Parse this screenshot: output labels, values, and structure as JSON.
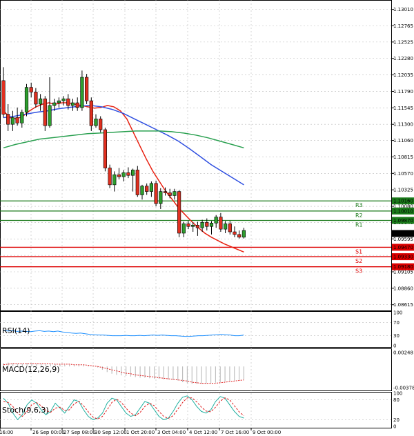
{
  "chart_data": [
    {
      "type": "candlestick",
      "title": "",
      "x_ticks": [
        "16:00",
        "26 Sep 00:00",
        "27 Sep 08:00",
        "30 Sep 12:00",
        "1 Oct 20:00",
        "3 Oct 04:00",
        "4 Oct 12:00",
        "7 Oct 16:00",
        "9 Oct 00:00"
      ],
      "y_ticks": [
        1.1301,
        1.12765,
        1.12525,
        1.1228,
        1.12035,
        1.1179,
        1.11545,
        1.113,
        1.1106,
        1.10815,
        1.1057,
        1.10325,
        1.1008,
        1.0984,
        1.09595,
        1.0935,
        1.09105,
        1.0886,
        1.08615
      ],
      "y_tick_labels": [
        "1.13010",
        "1.12765",
        "1.12525",
        "1.12280",
        "1.12035",
        "1.11790",
        "1.11545",
        "1.11300",
        "1.11060",
        "1.10815",
        "1.10570",
        "1.10325",
        "1.10080",
        "1.09840",
        "1.09595",
        "1.09350",
        "1.09105",
        "1.08860",
        "1.08615"
      ],
      "ylim": [
        1.0853,
        1.1315
      ],
      "current_price": {
        "value": 1.09675,
        "label": "1.09675"
      },
      "levels": [
        {
          "name": "R3",
          "value": 1.1016,
          "label": "1.10160",
          "color": "#1a7a1a"
        },
        {
          "name": "R2",
          "value": 1.1001,
          "label": "1.10010",
          "color": "#1a7a1a"
        },
        {
          "name": "R1",
          "value": 1.0987,
          "label": "1.09870",
          "color": "#1a7a1a"
        },
        {
          "name": "S1",
          "value": 1.0947,
          "label": "1.09470",
          "color": "#dd0000"
        },
        {
          "name": "S2",
          "value": 1.0933,
          "label": "1.09330",
          "color": "#dd0000"
        },
        {
          "name": "S3",
          "value": 1.0918,
          "label": "1.09180",
          "color": "#dd0000"
        }
      ],
      "candles": [
        {
          "o": 1.1195,
          "h": 1.1215,
          "l": 1.114,
          "c": 1.1145
        },
        {
          "o": 1.1145,
          "h": 1.116,
          "l": 1.112,
          "c": 1.113
        },
        {
          "o": 1.113,
          "h": 1.115,
          "l": 1.112,
          "c": 1.114
        },
        {
          "o": 1.114,
          "h": 1.1155,
          "l": 1.1128,
          "c": 1.1132
        },
        {
          "o": 1.1132,
          "h": 1.1152,
          "l": 1.1125,
          "c": 1.1148
        },
        {
          "o": 1.1148,
          "h": 1.119,
          "l": 1.1142,
          "c": 1.1185
        },
        {
          "o": 1.1185,
          "h": 1.1192,
          "l": 1.117,
          "c": 1.1178
        },
        {
          "o": 1.1178,
          "h": 1.1184,
          "l": 1.1155,
          "c": 1.116
        },
        {
          "o": 1.116,
          "h": 1.1175,
          "l": 1.115,
          "c": 1.1168
        },
        {
          "o": 1.1168,
          "h": 1.1172,
          "l": 1.112,
          "c": 1.1128
        },
        {
          "o": 1.1128,
          "h": 1.12,
          "l": 1.1125,
          "c": 1.1158
        },
        {
          "o": 1.1158,
          "h": 1.1168,
          "l": 1.115,
          "c": 1.1162
        },
        {
          "o": 1.1162,
          "h": 1.117,
          "l": 1.1155,
          "c": 1.1165
        },
        {
          "o": 1.1165,
          "h": 1.1172,
          "l": 1.1158,
          "c": 1.1168
        },
        {
          "o": 1.1168,
          "h": 1.1175,
          "l": 1.1152,
          "c": 1.1158
        },
        {
          "o": 1.1158,
          "h": 1.1168,
          "l": 1.115,
          "c": 1.1162
        },
        {
          "o": 1.1162,
          "h": 1.117,
          "l": 1.115,
          "c": 1.1155
        },
        {
          "o": 1.1155,
          "h": 1.121,
          "l": 1.115,
          "c": 1.12
        },
        {
          "o": 1.12,
          "h": 1.1205,
          "l": 1.116,
          "c": 1.1165
        },
        {
          "o": 1.1165,
          "h": 1.117,
          "l": 1.112,
          "c": 1.1128
        },
        {
          "o": 1.1128,
          "h": 1.1145,
          "l": 1.1125,
          "c": 1.1138
        },
        {
          "o": 1.1138,
          "h": 1.1142,
          "l": 1.1118,
          "c": 1.1122
        },
        {
          "o": 1.1122,
          "h": 1.1125,
          "l": 1.106,
          "c": 1.1065
        },
        {
          "o": 1.1065,
          "h": 1.107,
          "l": 1.1035,
          "c": 1.104
        },
        {
          "o": 1.104,
          "h": 1.106,
          "l": 1.103,
          "c": 1.1055
        },
        {
          "o": 1.1055,
          "h": 1.1065,
          "l": 1.1048,
          "c": 1.1052
        },
        {
          "o": 1.1052,
          "h": 1.1062,
          "l": 1.1045,
          "c": 1.1058
        },
        {
          "o": 1.1058,
          "h": 1.1066,
          "l": 1.105,
          "c": 1.1054
        },
        {
          "o": 1.1054,
          "h": 1.1064,
          "l": 1.103,
          "c": 1.1062
        },
        {
          "o": 1.1062,
          "h": 1.1068,
          "l": 1.1022,
          "c": 1.1025
        },
        {
          "o": 1.1025,
          "h": 1.104,
          "l": 1.1018,
          "c": 1.1038
        },
        {
          "o": 1.1038,
          "h": 1.1042,
          "l": 1.1025,
          "c": 1.103
        },
        {
          "o": 1.103,
          "h": 1.1045,
          "l": 1.1022,
          "c": 1.1042
        },
        {
          "o": 1.1042,
          "h": 1.1046,
          "l": 1.1008,
          "c": 1.1012
        },
        {
          "o": 1.1012,
          "h": 1.1035,
          "l": 1.1004,
          "c": 1.103
        },
        {
          "o": 1.103,
          "h": 1.1036,
          "l": 1.1024,
          "c": 1.1028
        },
        {
          "o": 1.1028,
          "h": 1.1034,
          "l": 1.102,
          "c": 1.1024
        },
        {
          "o": 1.1024,
          "h": 1.1034,
          "l": 1.1018,
          "c": 1.103
        },
        {
          "o": 1.103,
          "h": 1.1032,
          "l": 1.0962,
          "c": 1.0968
        },
        {
          "o": 1.0968,
          "h": 1.0985,
          "l": 1.0962,
          "c": 1.0982
        },
        {
          "o": 1.0982,
          "h": 1.0986,
          "l": 1.0974,
          "c": 1.0978
        },
        {
          "o": 1.0978,
          "h": 1.0984,
          "l": 1.097,
          "c": 1.098
        },
        {
          "o": 1.098,
          "h": 1.0985,
          "l": 1.0964,
          "c": 1.0976
        },
        {
          "o": 1.0976,
          "h": 1.0988,
          "l": 1.097,
          "c": 1.0984
        },
        {
          "o": 1.0984,
          "h": 1.099,
          "l": 1.0972,
          "c": 1.0978
        },
        {
          "o": 1.0978,
          "h": 1.0986,
          "l": 1.0966,
          "c": 1.0983
        },
        {
          "o": 1.0983,
          "h": 1.0995,
          "l": 1.0976,
          "c": 1.0992
        },
        {
          "o": 1.0992,
          "h": 1.0998,
          "l": 1.097,
          "c": 1.0974
        },
        {
          "o": 1.0974,
          "h": 1.0986,
          "l": 1.0968,
          "c": 1.0982
        },
        {
          "o": 1.0982,
          "h": 1.0986,
          "l": 1.0966,
          "c": 1.097
        },
        {
          "o": 1.097,
          "h": 1.0978,
          "l": 1.0962,
          "c": 1.0966
        },
        {
          "o": 1.0966,
          "h": 1.0972,
          "l": 1.096,
          "c": 1.0962
        },
        {
          "o": 1.0962,
          "h": 1.0976,
          "l": 1.096,
          "c": 1.0972
        }
      ],
      "moving_averages": [
        {
          "color": "#e82010",
          "points": [
            1.115,
            1.114,
            1.1138,
            1.1142,
            1.115,
            1.1156,
            1.116,
            1.1162,
            1.116,
            1.1162,
            1.1162,
            1.116,
            1.1158,
            1.1156,
            1.1154,
            1.1155,
            1.1158,
            1.1156,
            1.115,
            1.1138,
            1.1118,
            1.1098,
            1.1078,
            1.106,
            1.1045,
            1.103,
            1.1018,
            1.1005,
            1.0995,
            1.0985,
            1.0976,
            1.0968,
            1.0962,
            1.0957,
            1.0952,
            1.0948,
            1.0944,
            1.094
          ]
        },
        {
          "color": "#3050e0",
          "points": [
            1.114,
            1.1142,
            1.1145,
            1.1148,
            1.115,
            1.1153,
            1.1155,
            1.1157,
            1.1158,
            1.1156,
            1.1152,
            1.1146,
            1.1138,
            1.113,
            1.1122,
            1.1114,
            1.1105,
            1.1094,
            1.1082,
            1.107,
            1.106,
            1.105,
            1.104
          ]
        },
        {
          "color": "#2aa050",
          "points": [
            1.1095,
            1.11,
            1.1104,
            1.1108,
            1.111,
            1.1112,
            1.1114,
            1.1116,
            1.1117,
            1.1118,
            1.1119,
            1.112,
            1.112,
            1.112,
            1.1119,
            1.1117,
            1.1114,
            1.111,
            1.1105,
            1.11,
            1.1095
          ]
        }
      ]
    },
    {
      "type": "line",
      "indicator": "RSI(14)",
      "y_ticks": [
        100,
        70,
        30,
        0
      ],
      "y_tick_labels": [
        "100",
        "70",
        "30",
        "0"
      ],
      "ylim": [
        0,
        100
      ],
      "levels": [
        70,
        30
      ],
      "color": "#1e90ff",
      "values": [
        46,
        44,
        45,
        43,
        44,
        43,
        42,
        44,
        45,
        43,
        44,
        42,
        44,
        41,
        40,
        38,
        37,
        38,
        36,
        34,
        33,
        32,
        32,
        31,
        30,
        30,
        30,
        31,
        30,
        30,
        31,
        30,
        31,
        32,
        31,
        32,
        31,
        30,
        30,
        29,
        28,
        28,
        29,
        30,
        30,
        31,
        32,
        33,
        34,
        33,
        32,
        30,
        30,
        32
      ]
    },
    {
      "type": "bar",
      "indicator": "MACD(12,26,9)",
      "y_ticks": [
        0.00248,
        -0.003788
      ],
      "y_tick_labels": [
        "0.00248",
        "-0.003788"
      ],
      "ylim": [
        -0.003788,
        0.00248
      ],
      "signal_color": "#e02020",
      "histogram_color": "#c0c0c0",
      "histogram": [
        0.0006,
        0.0007,
        0.0006,
        0.0005,
        0.0005,
        0.0006,
        0.0006,
        0.0005,
        0.0005,
        0.0004,
        0.0004,
        0.0004,
        0.0004,
        0.0003,
        0.0003,
        0.0003,
        0.0004,
        0.0003,
        0.0002,
        0.0001,
        -0.0002,
        -0.0006,
        -0.001,
        -0.0013,
        -0.0015,
        -0.0016,
        -0.0017,
        -0.0018,
        -0.0019,
        -0.002,
        -0.002,
        -0.0021,
        -0.0022,
        -0.0022,
        -0.0023,
        -0.0023,
        -0.0024,
        -0.0025,
        -0.0028,
        -0.003,
        -0.0031,
        -0.0031,
        -0.0031,
        -0.0031,
        -0.003,
        -0.0029,
        -0.0028,
        -0.0027,
        -0.0026,
        -0.0025,
        -0.0024,
        -0.0023
      ],
      "signal": [
        0.0003,
        0.0004,
        0.0005,
        0.0005,
        0.0005,
        0.0005,
        0.0005,
        0.0005,
        0.0005,
        0.0005,
        0.0005,
        0.0004,
        0.0004,
        0.0004,
        0.0004,
        0.0003,
        0.0003,
        0.0003,
        0.0002,
        0.0001,
        0.0,
        -0.0002,
        -0.0004,
        -0.0006,
        -0.0008,
        -0.001,
        -0.0012,
        -0.0013,
        -0.0015,
        -0.0016,
        -0.0017,
        -0.0018,
        -0.0019,
        -0.002,
        -0.0021,
        -0.0022,
        -0.0023,
        -0.0024,
        -0.0025,
        -0.0026,
        -0.0028,
        -0.0029,
        -0.003,
        -0.003,
        -0.003,
        -0.003,
        -0.0029,
        -0.0028,
        -0.0027,
        -0.0026,
        -0.0025,
        -0.0024
      ]
    },
    {
      "type": "line",
      "indicator": "Stoch(9,6,3)",
      "y_ticks": [
        100,
        80,
        20,
        0
      ],
      "y_tick_labels": [
        "100",
        "80",
        "20",
        "0"
      ],
      "ylim": [
        0,
        100
      ],
      "levels": [
        80,
        20
      ],
      "main_color": "#20b0a0",
      "signal_color": "#e02020",
      "main": [
        85,
        70,
        40,
        20,
        35,
        65,
        80,
        70,
        50,
        35,
        45,
        70,
        55,
        40,
        60,
        80,
        75,
        50,
        30,
        20,
        25,
        40,
        70,
        85,
        80,
        60,
        40,
        30,
        35,
        55,
        75,
        70,
        50,
        30,
        20,
        25,
        45,
        70,
        88,
        92,
        80,
        60,
        45,
        40,
        50,
        75,
        90,
        85,
        65,
        45,
        30,
        25
      ],
      "signal": [
        75,
        72,
        60,
        40,
        30,
        45,
        65,
        72,
        62,
        48,
        42,
        55,
        58,
        48,
        50,
        68,
        76,
        62,
        44,
        28,
        22,
        30,
        50,
        72,
        82,
        72,
        55,
        40,
        32,
        42,
        60,
        70,
        62,
        45,
        30,
        24,
        32,
        52,
        72,
        86,
        86,
        74,
        58,
        46,
        44,
        58,
        76,
        86,
        80,
        62,
        44,
        32
      ]
    }
  ]
}
